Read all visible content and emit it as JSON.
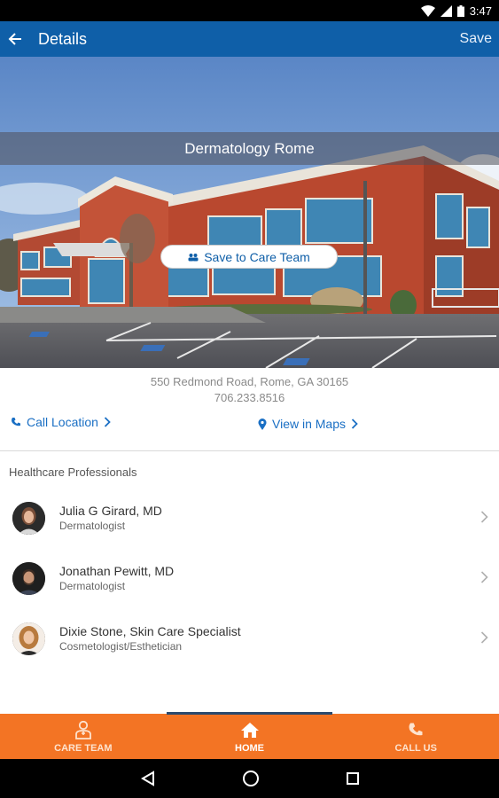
{
  "status_bar": {
    "time": "3:47"
  },
  "app_bar": {
    "title": "Details",
    "save_label": "Save"
  },
  "hero": {
    "location_name": "Dermatology Rome",
    "save_care_team_label": "Save to Care Team"
  },
  "location": {
    "address": "550 Redmond Road, Rome, GA 30165",
    "phone": "706.233.8516",
    "call_label": "Call Location",
    "maps_label": "View in Maps"
  },
  "section_title": "Healthcare Professionals",
  "professionals": [
    {
      "name": "Julia G Girard, MD",
      "role": "Dermatologist"
    },
    {
      "name": "Jonathan Pewitt, MD",
      "role": "Dermatologist"
    },
    {
      "name": "Dixie Stone, Skin Care Specialist",
      "role": "Cosmetologist/Esthetician"
    }
  ],
  "bottom_nav": [
    {
      "label": "CARE TEAM",
      "icon": "doctor-icon",
      "active": false
    },
    {
      "label": "HOME",
      "icon": "home-icon",
      "active": true
    },
    {
      "label": "CALL US",
      "icon": "phone-icon",
      "active": false
    }
  ],
  "colors": {
    "app_bar": "#0f5fa8",
    "accent_link": "#1a6fc4",
    "bottom_nav": "#f37424"
  }
}
